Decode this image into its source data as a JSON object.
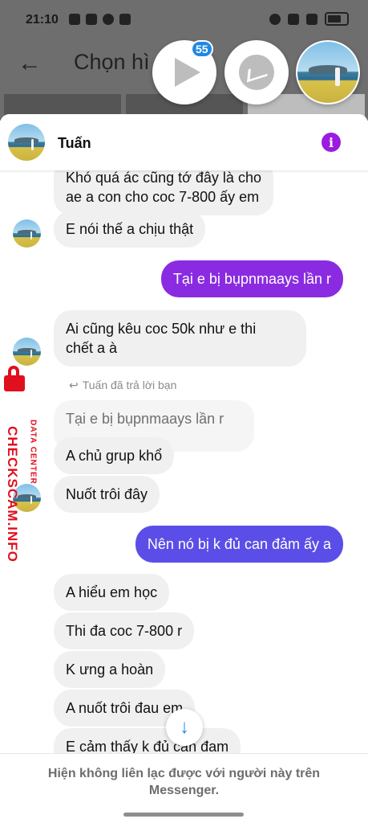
{
  "status_bar": {
    "time": "21:10",
    "battery": "battery-icon",
    "wifi": "wifi-icon"
  },
  "background_app": {
    "title": "Chọn hì",
    "back": "back-arrow-icon"
  },
  "chat_heads": {
    "badge_count": "55"
  },
  "chat": {
    "contact_name": "Tuấn",
    "messages": [
      {
        "side": "in",
        "text": "Khó quá ác cũng tớ đây là cho\nae a con cho coc 7-800 ấy em"
      },
      {
        "side": "in",
        "text": "E nói thế a chịu thật"
      },
      {
        "side": "out",
        "text": "Tại e bị bụpnmaays lần r"
      },
      {
        "side": "in",
        "text": "Ai cũng kêu coc 50k như e thi\nchết a à"
      },
      {
        "side": "note",
        "text": "Tuấn đã trả lời bạn"
      },
      {
        "side": "quote",
        "text": "Tại e bị bụpnmaays lần r"
      },
      {
        "side": "in",
        "text": "A chủ grup khổ"
      },
      {
        "side": "in",
        "text": "Nuốt trôi đây"
      },
      {
        "side": "out",
        "text": "Nên nó bị k đủ can đảm ấy a"
      },
      {
        "side": "in",
        "text": "A hiểu em học"
      },
      {
        "side": "in",
        "text": "Thi đa coc 7-800 r"
      },
      {
        "side": "in",
        "text": "K ưng a hoàn"
      },
      {
        "side": "in",
        "text": "A nuốt trôi đau em"
      },
      {
        "side": "in",
        "text": "E cảm thấy k đủ can đam"
      }
    ],
    "footer_notice": "Hiện không liên lạc được với người này trên Messenger."
  },
  "watermark": {
    "brand": "CHECKSCAM.INFO",
    "subtitle": "DATA CENTER"
  },
  "colors": {
    "outgoing_1": "#8a2be2",
    "outgoing_2": "#5b4ee8",
    "info": "#9b1ce0",
    "watermark": "#e0101e"
  }
}
